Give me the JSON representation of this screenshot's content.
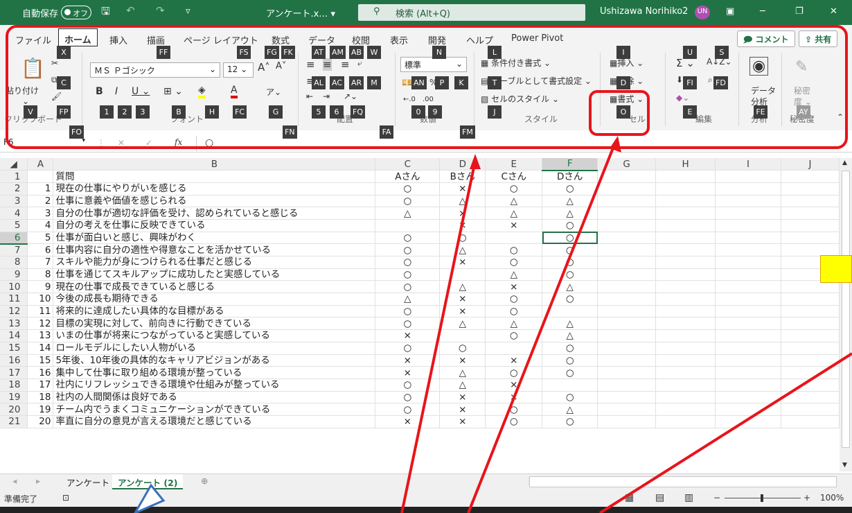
{
  "title_bar": {
    "autosave_label": "自動保存",
    "autosave_toggle": "オフ",
    "filename": "アンケート.x… ▾",
    "search_placeholder": "検索 (Alt+Q)",
    "user_name": "Ushizawa Norihiko2",
    "user_initials": "UN",
    "brand_color": "#217346"
  },
  "tabs": [
    "ファイル",
    "ホーム",
    "挿入",
    "描画",
    "ページ レイアウト",
    "数式",
    "データ",
    "校閲",
    "表示",
    "開発",
    "ヘルプ",
    "Power Pivot"
  ],
  "comment_button": "コメント",
  "share_button": "共有",
  "ribbon": {
    "paste_label": "貼り付け",
    "font_name": "ＭＳ Ｐゴシック",
    "font_size": "12",
    "number_format": "標準",
    "cond_format": "条件付き書式 ⌄",
    "table_format": "テーブルとして書式設定 ⌄",
    "cell_style": "セルのスタイル ⌄",
    "insert": "挿入",
    "delete": "削除",
    "format": "書式",
    "data_analysis_1": "データ",
    "data_analysis_2": "分析",
    "sensitivity_1": "秘密",
    "sensitivity_2": "度 ⌄",
    "groups": {
      "clipboard": "クリップボード",
      "font": "フォント",
      "align": "配置",
      "number": "数値",
      "style": "スタイル",
      "cells": "セル",
      "edit": "編集",
      "analysis": "分析",
      "sensitivity": "秘密度"
    }
  },
  "key_tips": {
    "X": "X",
    "C": "C",
    "V": "V",
    "FP": "FP",
    "FO": "FO",
    "FF": "FF",
    "FS": "FS",
    "FG": "FG",
    "FK": "FK",
    "n1": "1",
    "n2": "2",
    "n3": "3",
    "B": "B",
    "H": "H",
    "FC": "FC",
    "G": "G",
    "FN": "FN",
    "AT": "AT",
    "AM": "AM",
    "AB": "AB",
    "W": "W",
    "AL": "AL",
    "AC": "AC",
    "AR": "AR",
    "M": "M",
    "n5": "5",
    "n6": "6",
    "FQ": "FQ",
    "FA": "FA",
    "N": "N",
    "AN": "AN",
    "P": "P",
    "K": "K",
    "n0": "0",
    "n9": "9",
    "FM": "FM",
    "L": "L",
    "T": "T",
    "J": "J",
    "I": "I",
    "D": "D",
    "O": "O",
    "U": "U",
    "S": "S",
    "FI": "FI",
    "FD": "FD",
    "E": "E",
    "FE": "FE",
    "AY": "AY"
  },
  "formula_bar": {
    "name_box": "F6",
    "fx": "fx",
    "value": "○"
  },
  "columns": [
    "A",
    "B",
    "C",
    "D",
    "E",
    "F",
    "G",
    "H",
    "I",
    "J"
  ],
  "sheet": {
    "header": {
      "b": "質問",
      "c": "Aさん",
      "d": "Bさん",
      "e": "Cさん",
      "f": "Dさん"
    },
    "rows": [
      {
        "a": "1",
        "q": "現在の仕事にやりがいを感じる",
        "c": "○",
        "d": "×",
        "e": "○",
        "f": "○"
      },
      {
        "a": "2",
        "q": "仕事に意義や価値を感じられる",
        "c": "○",
        "d": "△",
        "e": "△",
        "f": "△"
      },
      {
        "a": "3",
        "q": "自分の仕事が適切な評価を受け、認められていると感じる",
        "c": "△",
        "d": "×",
        "e": "△",
        "f": "△"
      },
      {
        "a": "4",
        "q": "自分の考えを仕事に反映できている",
        "c": "",
        "d": "×",
        "e": "×",
        "f": "○"
      },
      {
        "a": "5",
        "q": "仕事が面白いと感じ、興味がわく",
        "c": "○",
        "d": "○",
        "e": "",
        "f": "○"
      },
      {
        "a": "6",
        "q": "仕事内容に自分の適性や得意なことを活かせている",
        "c": "○",
        "d": "△",
        "e": "○",
        "f": "○"
      },
      {
        "a": "7",
        "q": "スキルや能力が身につけられる仕事だと感じる",
        "c": "○",
        "d": "×",
        "e": "○",
        "f": "○"
      },
      {
        "a": "8",
        "q": "仕事を通じてスキルアップに成功したと実感している",
        "c": "○",
        "d": "",
        "e": "△",
        "f": "○"
      },
      {
        "a": "9",
        "q": "現在の仕事で成長できていると感じる",
        "c": "○",
        "d": "△",
        "e": "×",
        "f": "△"
      },
      {
        "a": "10",
        "q": "今後の成長も期待できる",
        "c": "△",
        "d": "×",
        "e": "○",
        "f": "○"
      },
      {
        "a": "11",
        "q": "将来的に達成したい具体的な目標がある",
        "c": "○",
        "d": "×",
        "e": "○",
        "f": ""
      },
      {
        "a": "12",
        "q": "目標の実現に対して、前向きに行動できている",
        "c": "○",
        "d": "△",
        "e": "△",
        "f": "△"
      },
      {
        "a": "13",
        "q": "いまの仕事が将来につながっていると実感している",
        "c": "×",
        "d": "",
        "e": "○",
        "f": "△"
      },
      {
        "a": "14",
        "q": "ロールモデルにしたい人物がいる",
        "c": "○",
        "d": "○",
        "e": "",
        "f": "○"
      },
      {
        "a": "15",
        "q": "5年後、10年後の具体的なキャリアビジョンがある",
        "c": "×",
        "d": "×",
        "e": "×",
        "f": "○"
      },
      {
        "a": "16",
        "q": "集中して仕事に取り組める環境が整っている",
        "c": "×",
        "d": "△",
        "e": "○",
        "f": "○"
      },
      {
        "a": "17",
        "q": "社内にリフレッシュできる環境や仕組みが整っている",
        "c": "○",
        "d": "△",
        "e": "×",
        "f": ""
      },
      {
        "a": "18",
        "q": "社内の人間関係は良好である",
        "c": "○",
        "d": "×",
        "e": "×",
        "f": "○"
      },
      {
        "a": "19",
        "q": "チーム内でうまくコミュニケーションができている",
        "c": "○",
        "d": "×",
        "e": "○",
        "f": "△"
      },
      {
        "a": "20",
        "q": "率直に自分の意見が言える環境だと感じている",
        "c": "×",
        "d": "×",
        "e": "○",
        "f": "○"
      }
    ]
  },
  "sheet_tabs": [
    "アンケート",
    "アンケート (2)"
  ],
  "status": {
    "ready": "準備完了",
    "zoom": "100%"
  },
  "annotation_color": "#e8141b"
}
